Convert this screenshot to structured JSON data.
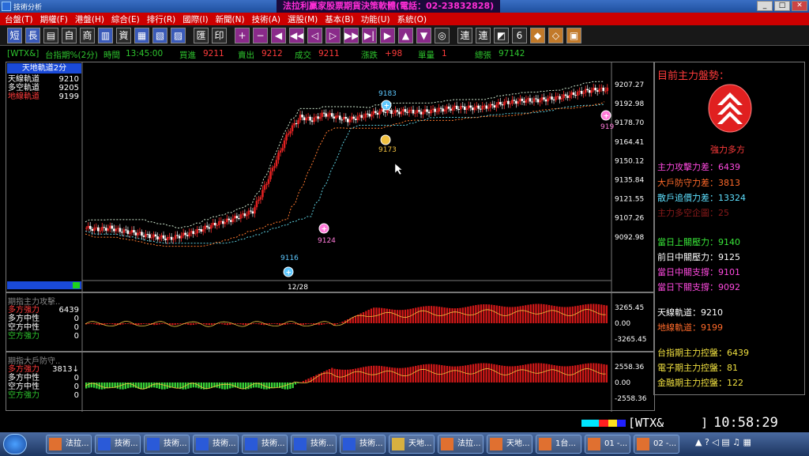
{
  "window": {
    "title": "技術分析",
    "banner": "法拉利贏家股票期貨決策軟體(電話：02-23832828)"
  },
  "menu": [
    "台盤(T)",
    "期權(F)",
    "港盤(H)",
    "綜合(E)",
    "排行(R)",
    "國際(I)",
    "新聞(N)",
    "技術(A)",
    "選股(M)",
    "基本(B)",
    "功能(U)",
    "系統(O)"
  ],
  "toolbar": [
    {
      "label": "短",
      "icon": "short-icon"
    },
    {
      "label": "長",
      "icon": "long-icon"
    },
    {
      "label": "▤",
      "icon": "list-icon"
    },
    {
      "label": "自",
      "icon": "self-icon"
    },
    {
      "label": "商",
      "icon": "commodity-icon"
    },
    {
      "label": "▥",
      "icon": "grid-icon"
    },
    {
      "label": "資",
      "icon": "data-icon"
    },
    {
      "label": "▦",
      "icon": "table-icon"
    },
    {
      "label": "▧",
      "icon": "sheet-icon"
    },
    {
      "label": "▨",
      "icon": "report-icon"
    },
    {
      "label": "匯",
      "icon": "exchange-icon"
    },
    {
      "label": "印",
      "icon": "print-icon"
    },
    {
      "label": "+",
      "icon": "plus-icon"
    },
    {
      "label": "−",
      "icon": "minus-icon"
    },
    {
      "label": "◀",
      "icon": "left-icon"
    },
    {
      "label": "◀◀",
      "icon": "rewind-icon"
    },
    {
      "label": "◁",
      "icon": "prev-icon"
    },
    {
      "label": "▷",
      "icon": "next-icon"
    },
    {
      "label": "▶▶",
      "icon": "forward-icon"
    },
    {
      "label": "▶|",
      "icon": "end-icon"
    },
    {
      "label": "▶",
      "icon": "right-icon"
    },
    {
      "label": "▲",
      "icon": "up-icon"
    },
    {
      "label": "▼",
      "icon": "down-icon"
    },
    {
      "label": "◎",
      "icon": "target-icon"
    },
    {
      "label": "連",
      "icon": "link-icon"
    },
    {
      "label": "連",
      "icon": "link2-icon"
    },
    {
      "label": "◩",
      "icon": "window-icon"
    },
    {
      "label": "6",
      "icon": "six-icon"
    },
    {
      "label": "◆",
      "icon": "diamond-icon"
    },
    {
      "label": "◇",
      "icon": "diamond2-icon"
    },
    {
      "label": "▣",
      "icon": "box-icon"
    }
  ],
  "info": {
    "code": "[WTX&]",
    "name": "台指期%(2分)",
    "time_label": "時間",
    "time": "13:45:00",
    "bid_label": "買進",
    "bid": "9211",
    "ask_label": "賣出",
    "ask": "9212",
    "trade_label": "成交",
    "trade": "9211",
    "change_label": "漲跌",
    "change": "+98",
    "vol_label": "單量",
    "vol": "1",
    "total_label": "總張",
    "total": "97142"
  },
  "main": {
    "title": "天地軌道2分",
    "legend": [
      {
        "name": "天線軌道",
        "value": "9210",
        "color": "#ffffff"
      },
      {
        "name": "多空軌道",
        "value": "9205",
        "color": "#ffffff"
      },
      {
        "name": "地線軌道",
        "value": "9199",
        "color": "#ff3b3b"
      }
    ],
    "yticks": [
      "9207.27",
      "9192.98",
      "9178.70",
      "9164.41",
      "9150.12",
      "9135.84",
      "9121.55",
      "9107.26",
      "9092.98"
    ],
    "date_label": "12/28",
    "markers": [
      {
        "label": "9183",
        "color": "#5ec8ff"
      },
      {
        "label": "9173",
        "color": "#f0c040"
      },
      {
        "label": "9116",
        "color": "#5ec8ff"
      },
      {
        "label": "9124",
        "color": "#ff7ad9"
      },
      {
        "label": "919",
        "color": "#ff7ad9"
      }
    ]
  },
  "chart_data": [
    {
      "type": "candlestick",
      "title": "天地軌道2分",
      "x": "2-minute bars, 12/28",
      "ylim": [
        9092.98,
        9207.27
      ],
      "series": [
        {
          "name": "天線軌道",
          "last": 9210
        },
        {
          "name": "多空軌道",
          "last": 9205
        },
        {
          "name": "地線軌道",
          "last": 9199
        }
      ],
      "annotations": [
        {
          "label": "9116",
          "y": 9116
        },
        {
          "label": "9124",
          "y": 9124
        },
        {
          "label": "9183",
          "y": 9183
        },
        {
          "label": "9173",
          "y": 9173
        }
      ],
      "approx_close_path": [
        9113,
        9112,
        9113,
        9111,
        9110,
        9108,
        9107,
        9106,
        9108,
        9110,
        9113,
        9116,
        9118,
        9121,
        9124,
        9140,
        9158,
        9176,
        9186,
        9184,
        9188,
        9186,
        9184,
        9186,
        9188,
        9190,
        9189,
        9190,
        9189,
        9190,
        9191,
        9192,
        9192,
        9192,
        9193,
        9195,
        9196,
        9197,
        9197,
        9198,
        9199,
        9201,
        9203,
        9204
      ]
    },
    {
      "type": "bar",
      "title": "期指主力攻擊..",
      "ylim": [
        -3265.45,
        3265.45
      ],
      "yticks": [
        "3265.45",
        "0.00",
        "-3265.45"
      ],
      "legend": [
        {
          "name": "多方強力",
          "value": "6439"
        },
        {
          "name": "多方中性",
          "value": "0"
        },
        {
          "name": "空方中性",
          "value": "0"
        },
        {
          "name": "空方強力",
          "value": "0"
        }
      ]
    },
    {
      "type": "bar",
      "title": "期指大戶防守..",
      "ylim": [
        -2558.36,
        2558.36
      ],
      "yticks": [
        "2558.36",
        "0.00",
        "-2558.36"
      ],
      "legend": [
        {
          "name": "多方強力",
          "value": "3813"
        },
        {
          "name": "多方中性",
          "value": "0"
        },
        {
          "name": "空方中性",
          "value": "0"
        },
        {
          "name": "空方強力",
          "value": "0"
        }
      ]
    }
  ],
  "ind1": {
    "title": "期指主力攻擊..",
    "legend": [
      {
        "name": "多方強力",
        "value": "6439",
        "color": "#ff3b3b"
      },
      {
        "name": "多方中性",
        "value": "0",
        "color": "#ffffff"
      },
      {
        "name": "空方中性",
        "value": "0",
        "color": "#ffffff"
      },
      {
        "name": "空方強力",
        "value": "0",
        "color": "#2ec42e"
      }
    ],
    "yticks": [
      "3265.45",
      "0.00",
      "-3265.45"
    ]
  },
  "ind2": {
    "title": "期指大戶防守..",
    "legend": [
      {
        "name": "多方強力",
        "value": "3813↓",
        "color": "#ff3b3b"
      },
      {
        "name": "多方中性",
        "value": "0",
        "color": "#ffffff"
      },
      {
        "name": "空方中性",
        "value": "0",
        "color": "#ffffff"
      },
      {
        "name": "空方強力",
        "value": "0",
        "color": "#2ec42e"
      }
    ],
    "yticks": [
      "2558.36",
      "0.00",
      "-2558.36"
    ]
  },
  "sidebar": {
    "title": "目前主力盤勢：",
    "signal": "強力多方",
    "items": [
      {
        "text": "主力攻擊力差：6439",
        "color": "#ff4ae0"
      },
      {
        "text": "大戶防守力差：3813",
        "color": "#ff6a2a"
      },
      {
        "text": "散戶追價力差：13324",
        "color": "#5ee0ff"
      },
      {
        "text": "主力多空企圖：25",
        "color": "#8a1a1a"
      },
      {
        "text": "當日上關壓力：9140",
        "color": "#39e739"
      },
      {
        "text": "前日中關壓力：9125",
        "color": "#ffffff"
      },
      {
        "text": "當日中關支撐：9101",
        "color": "#ff4ae0"
      },
      {
        "text": "當日下關支撐：9092",
        "color": "#ff4ae0"
      },
      {
        "text": "天線軌道：9210",
        "color": "#ffffff"
      },
      {
        "text": "地線軌道：9199",
        "color": "#ff6a2a"
      },
      {
        "text": "台指期主力控盤：6439",
        "color": "#f0e040"
      },
      {
        "text": "電子期主力控盤：81",
        "color": "#f0e040"
      },
      {
        "text": "金融期主力控盤：122",
        "color": "#f0e040"
      }
    ]
  },
  "status": {
    "code": "[WTX&",
    "close": "]",
    "clock": "10:58:29"
  },
  "taskbar": [
    {
      "label": "法拉..."
    },
    {
      "label": "技術..."
    },
    {
      "label": "技術..."
    },
    {
      "label": "技術..."
    },
    {
      "label": "技術..."
    },
    {
      "label": "技術..."
    },
    {
      "label": "技術..."
    },
    {
      "label": "天地..."
    },
    {
      "label": "法拉..."
    },
    {
      "label": "天地..."
    },
    {
      "label": "1台..."
    },
    {
      "label": "01 -..."
    },
    {
      "label": "02 -..."
    }
  ]
}
